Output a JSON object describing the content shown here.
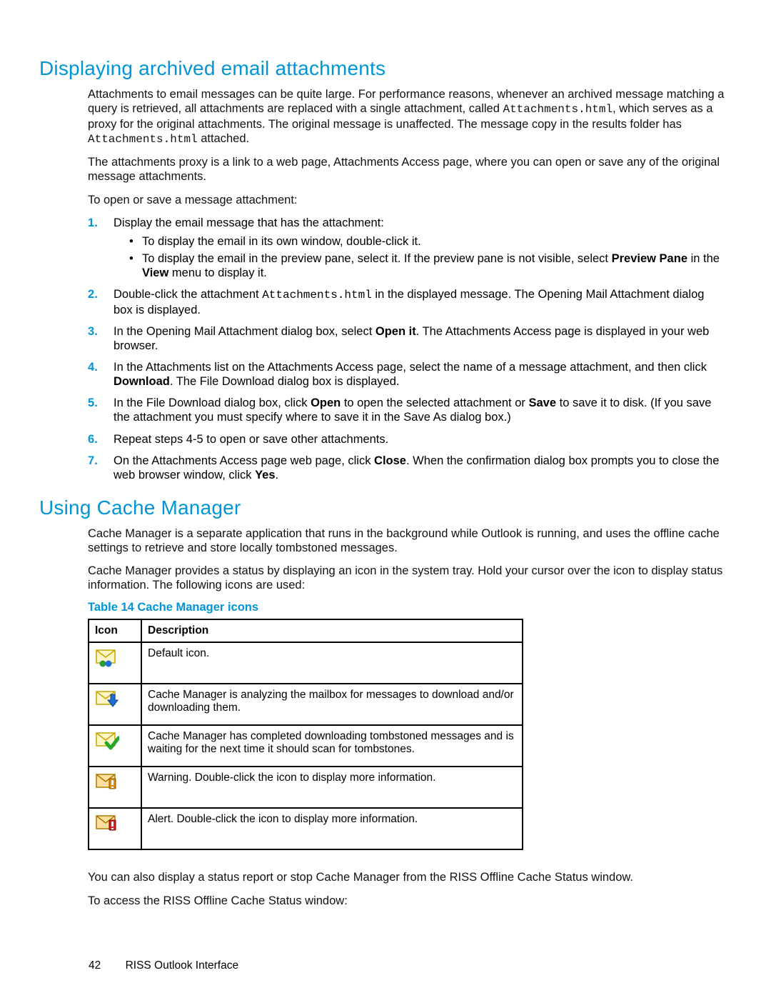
{
  "section1": {
    "heading": "Displaying archived email attachments",
    "para1_a": "Attachments to email messages can be quite large. For performance reasons, whenever an archived message matching a query is retrieved, all attachments are replaced with a single attachment, called ",
    "para1_code1": "Attachments.html",
    "para1_b": ", which serves as a proxy for the original attachments. The original message is unaffected. The message copy in the results folder has ",
    "para1_code2": "Attachments.html",
    "para1_c": " attached.",
    "para2": "The attachments proxy is a link to a web page, Attachments Access page, where you can open or save any of the original message attachments.",
    "para3": "To open or save a message attachment:",
    "step1_lead": "Display the email message that has the attachment:",
    "step1_b1": "To display the email in its own window, double-click it.",
    "step1_b2_a": "To display the email in the preview pane, select it. If the preview pane is not visible, select ",
    "step1_b2_bold1": "Preview Pane",
    "step1_b2_b": " in the ",
    "step1_b2_bold2": "View",
    "step1_b2_c": " menu to display it.",
    "step2_a": "Double-click the attachment ",
    "step2_code": "Attachments.html",
    "step2_b": " in the displayed message. The Opening Mail Attachment dialog box is displayed.",
    "step3_a": "In the Opening Mail Attachment dialog box, select ",
    "step3_bold": "Open it",
    "step3_b": ". The Attachments Access page is displayed in your web browser.",
    "step4_a": "In the Attachments list on the Attachments Access page, select the name of a message attachment, and then click ",
    "step4_bold": "Download",
    "step4_b": ". The File Download dialog box is displayed.",
    "step5_a": "In the File Download dialog box, click ",
    "step5_bold1": "Open",
    "step5_b": " to open the selected attachment or ",
    "step5_bold2": "Save",
    "step5_c": " to save it to disk. (If you save the attachment you must specify where to save it in the Save As dialog box.)",
    "step6": "Repeat steps 4-5 to open or save other attachments.",
    "step7_a": "On the Attachments Access page web page, click ",
    "step7_bold1": "Close",
    "step7_b": ". When the confirmation dialog box prompts you to close the web browser window, click ",
    "step7_bold2": "Yes",
    "step7_c": "."
  },
  "section2": {
    "heading": "Using Cache Manager",
    "para1": "Cache Manager is a separate application that runs in the background while Outlook is running, and uses the offline cache settings to retrieve and store locally tombstoned messages.",
    "para2": "Cache Manager provides a status by displaying an icon in the system tray. Hold your cursor over the icon to display status information. The following icons are used:",
    "table_caption": "Table 14 Cache Manager icons",
    "th_icon": "Icon",
    "th_desc": "Description",
    "rows": {
      "r0": "Default icon.",
      "r1": "Cache Manager is analyzing the mailbox for messages to download and/or downloading them.",
      "r2": "Cache Manager has completed downloading tombstoned messages and is waiting for the next time it should scan for tombstones.",
      "r3": "Warning. Double-click the icon to display more information.",
      "r4": "Alert. Double-click the icon to display more information."
    },
    "para3": "You can also display a status report or stop Cache Manager from the RISS Offline Cache Status window.",
    "para4": "To access the RISS Offline Cache Status window:"
  },
  "footer": {
    "page": "42",
    "title": "RISS Outlook Interface"
  }
}
